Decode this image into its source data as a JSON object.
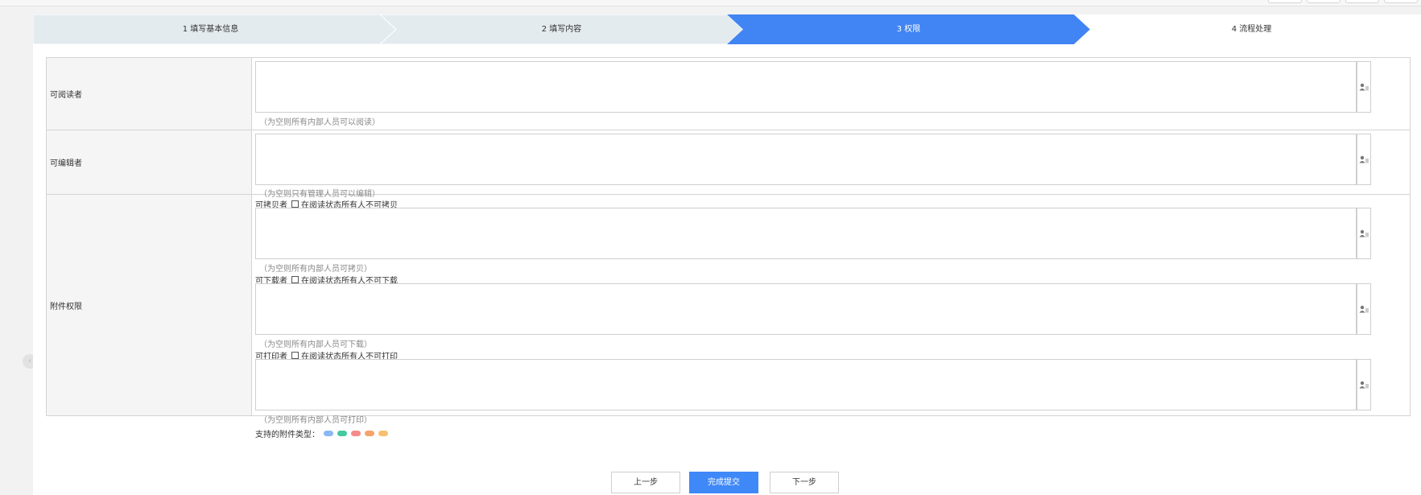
{
  "stepper": {
    "steps": [
      {
        "label": "1  填写基本信息"
      },
      {
        "label": "2  填写内容"
      },
      {
        "label": "3  权限"
      },
      {
        "label": "4  流程处理"
      }
    ],
    "active_index": 2,
    "colors": {
      "done": "#e4ebef",
      "active": "#4184f3",
      "pending": "#ffffff"
    }
  },
  "form": {
    "readers": {
      "label": "可阅读者",
      "hint": "（为空则所有内部人员可以阅读）"
    },
    "editors": {
      "label": "可编辑者",
      "hint": "（为空则只有管理人员可以编辑）"
    },
    "attachments": {
      "label": "附件权限",
      "copy": {
        "label": "可拷贝者",
        "checkbox_label": "在阅读状态所有人不可拷贝",
        "hint": "（为空则所有内部人员可拷贝）"
      },
      "download": {
        "label": "可下载者",
        "checkbox_label": "在阅读状态所有人不可下载",
        "hint": "（为空则所有内部人员可下载）"
      },
      "print": {
        "label": "可打印者",
        "checkbox_label": "在阅读状态所有人不可打印",
        "hint": "（为空则所有内部人员可打印）"
      },
      "types_label": "支持的附件类型：",
      "type_colors": [
        "#8ab8f7",
        "#45c9a0",
        "#f48b8b",
        "#f4a46b",
        "#f6c070"
      ]
    },
    "picker_icon": "address-book-icon"
  },
  "footer": {
    "prev": "上一步",
    "submit": "完成提交",
    "next": "下一步"
  }
}
